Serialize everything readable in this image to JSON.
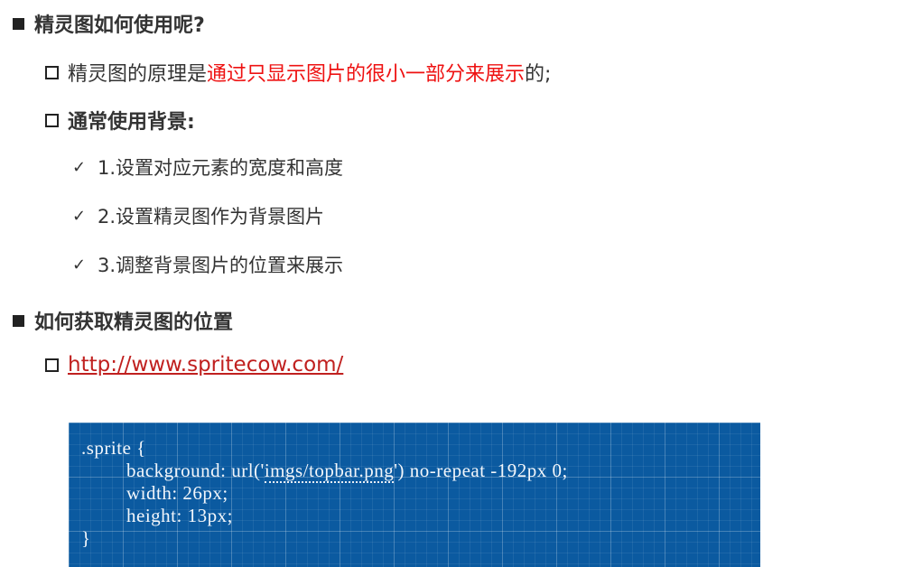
{
  "section1": {
    "heading": "精灵图如何使用呢?",
    "principle": {
      "prefix": "精灵图的原理是",
      "highlight": "通过只显示图片的很小一部分来展示",
      "suffix": "的;"
    },
    "usage_heading": "通常使用背景:",
    "steps": [
      "1.设置对应元素的宽度和高度",
      "2.设置精灵图作为背景图片",
      "3.调整背景图片的位置来展示"
    ]
  },
  "section2": {
    "heading": "如何获取精灵图的位置",
    "link": "http://www.spritecow.com/"
  },
  "code": {
    "line1": ".sprite {",
    "line2_prefix": "background: url('",
    "line2_path": "imgs/topbar.png",
    "line2_suffix": "') no-repeat -192px 0;",
    "line3": "width: 26px;",
    "line4": "height: 13px;",
    "line5": "}"
  },
  "colors": {
    "highlight": "#ee1111",
    "link": "#c0201f",
    "code_bg": "#0b5aa0"
  }
}
